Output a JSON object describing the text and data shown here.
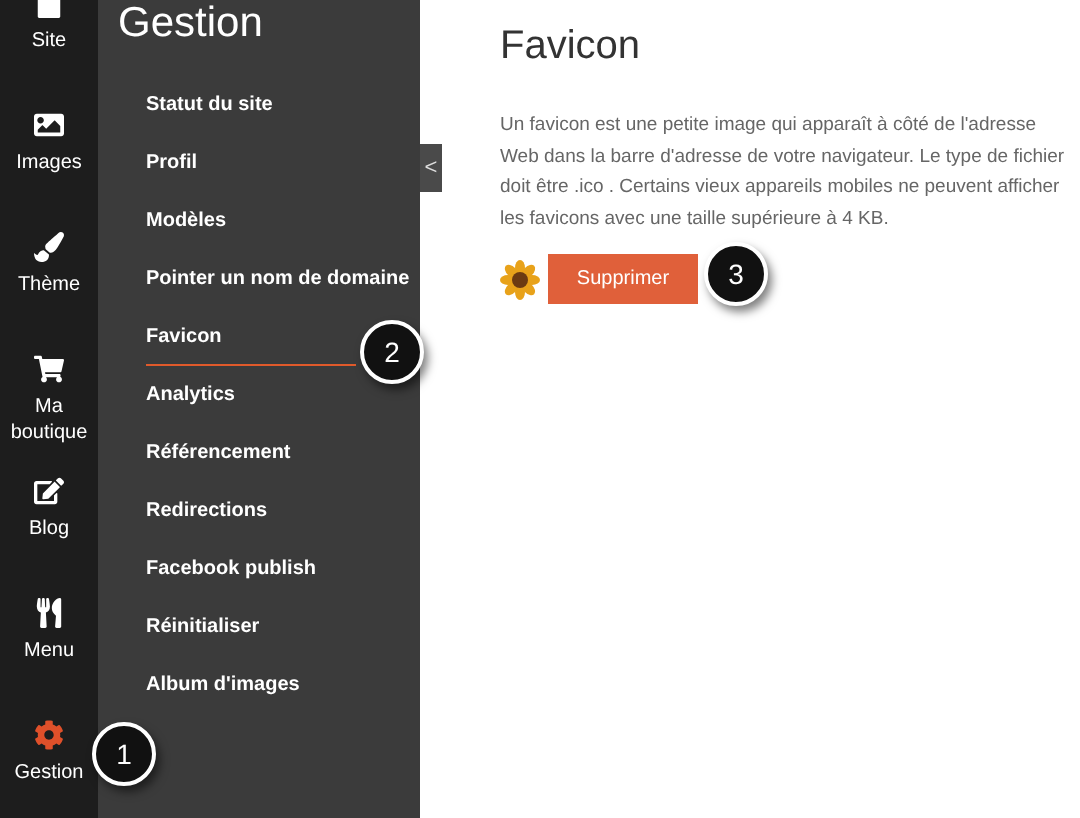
{
  "nav": [
    {
      "label": "Site",
      "selected": false
    },
    {
      "label": "Images",
      "selected": false
    },
    {
      "label": "Thème",
      "selected": false
    },
    {
      "label": "Ma boutique",
      "selected": false
    },
    {
      "label": "Blog",
      "selected": false
    },
    {
      "label": "Menu",
      "selected": false
    },
    {
      "label": "Gestion",
      "selected": true
    }
  ],
  "panel": {
    "title": "Gestion",
    "items": [
      {
        "label": "Statut du site",
        "selected": false
      },
      {
        "label": "Profil",
        "selected": false
      },
      {
        "label": "Modèles",
        "selected": false
      },
      {
        "label": "Pointer un nom de domaine",
        "selected": false
      },
      {
        "label": "Favicon",
        "selected": true
      },
      {
        "label": "Analytics",
        "selected": false
      },
      {
        "label": "Référencement",
        "selected": false
      },
      {
        "label": "Redirections",
        "selected": false
      },
      {
        "label": "Facebook publish",
        "selected": false
      },
      {
        "label": "Réinitialiser",
        "selected": false
      },
      {
        "label": "Album d'images",
        "selected": false
      }
    ]
  },
  "collapse": "<",
  "content": {
    "title": "Favicon",
    "text": "Un favicon est une petite image qui apparaît à côté de l'adresse Web dans la barre d'adresse de votre navigateur. Le type de fichier doit être .ico . Certains vieux appareils mobiles ne peuvent afficher les favicons avec une taille supérieure à 4 KB.",
    "button": "Supprimer"
  },
  "callouts": [
    {
      "text": "1"
    },
    {
      "text": "2"
    },
    {
      "text": "3"
    }
  ]
}
